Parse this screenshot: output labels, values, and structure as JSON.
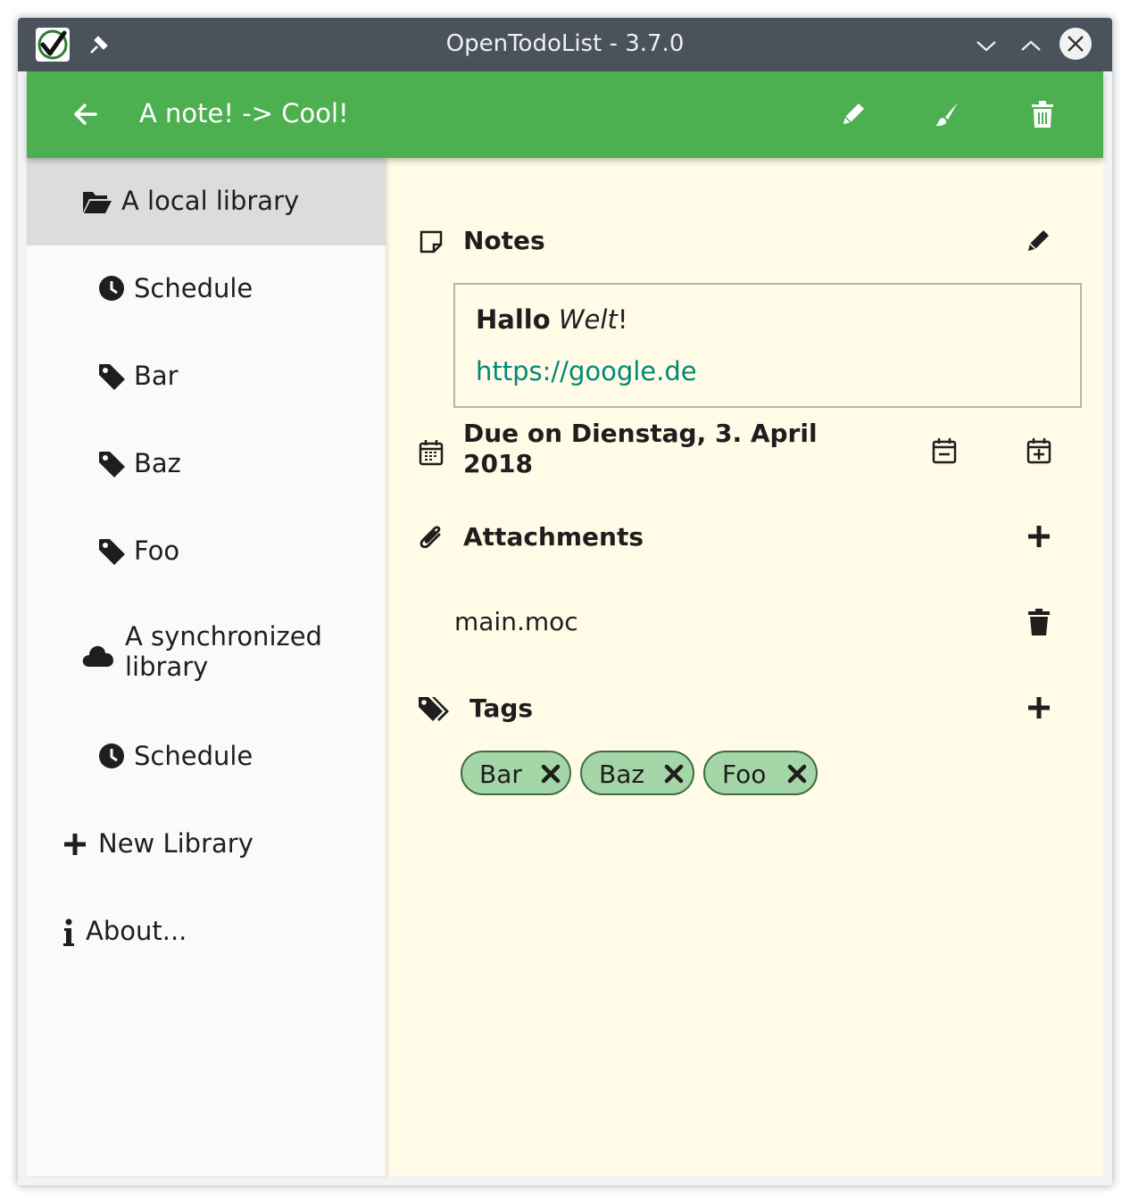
{
  "window": {
    "title": "OpenTodoList - 3.7.0"
  },
  "header": {
    "title": "A note! -> Cool!"
  },
  "sidebar": {
    "items": [
      {
        "label": "A local library",
        "icon": "folder-open-icon"
      },
      {
        "label": "Schedule",
        "icon": "clock-icon"
      },
      {
        "label": "Bar",
        "icon": "tag-icon"
      },
      {
        "label": "Baz",
        "icon": "tag-icon"
      },
      {
        "label": "Foo",
        "icon": "tag-icon"
      },
      {
        "label": "A synchronized library",
        "icon": "cloud-icon"
      },
      {
        "label": "Schedule",
        "icon": "clock-icon"
      },
      {
        "label": "New Library",
        "icon": "plus-icon"
      },
      {
        "label": "About...",
        "icon": "info-icon"
      }
    ]
  },
  "notes": {
    "title": "Notes",
    "bold": "Hallo",
    "italic": "Welt",
    "end": "!",
    "link": "https://google.de"
  },
  "due": {
    "line1": "Due on Dienstag, 3. April",
    "line2": "2018"
  },
  "attachments": {
    "title": "Attachments",
    "items": [
      "main.moc"
    ]
  },
  "tags": {
    "title": "Tags",
    "items": [
      "Bar",
      "Baz",
      "Foo"
    ]
  },
  "colors": {
    "accent": "#4caf50",
    "titlebar": "#4a535c",
    "tag_bg": "#a5d6a7",
    "link": "#00897b",
    "content_bg": "#fffbe6"
  }
}
